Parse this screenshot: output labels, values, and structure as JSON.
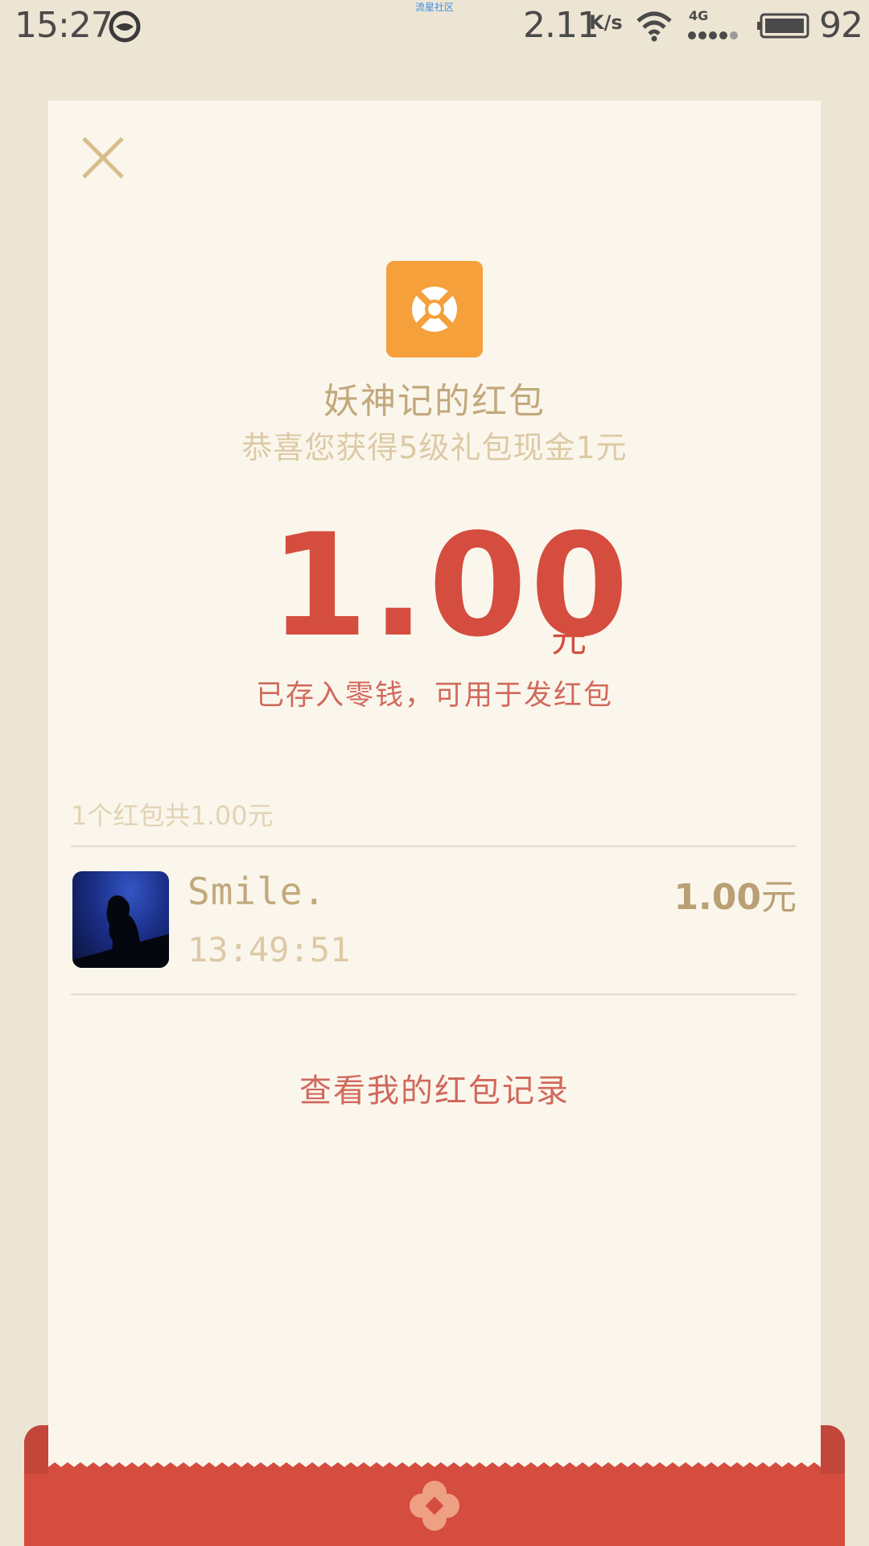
{
  "status_bar": {
    "time": "15:27",
    "watermark": "流星社区",
    "net_speed": "2.11",
    "net_speed_unit": "K/s",
    "network_type": "4G",
    "battery_percent": "92"
  },
  "header": {
    "close_icon": "close-icon",
    "app_icon": "qq-space-logo"
  },
  "red_packet": {
    "sender_title": "妖神记的红包",
    "greeting": "恭喜您获得5级礼包现金1元",
    "amount": "1.00",
    "amount_unit": "元",
    "amount_note": "已存入零钱，可用于发红包"
  },
  "records": {
    "summary": "1个红包共1.00元",
    "items": [
      {
        "name": "Smile.",
        "time": "13:49:51",
        "amount": "1.00",
        "unit": "元"
      }
    ]
  },
  "actions": {
    "view_history": "查看我的红包记录"
  },
  "colors": {
    "page_bg": "#ede5d4",
    "card_bg": "#fbf6ec",
    "accent_red": "#d44d3f",
    "gold_text": "#c2a97c",
    "app_icon_orange": "#f5a03b"
  }
}
